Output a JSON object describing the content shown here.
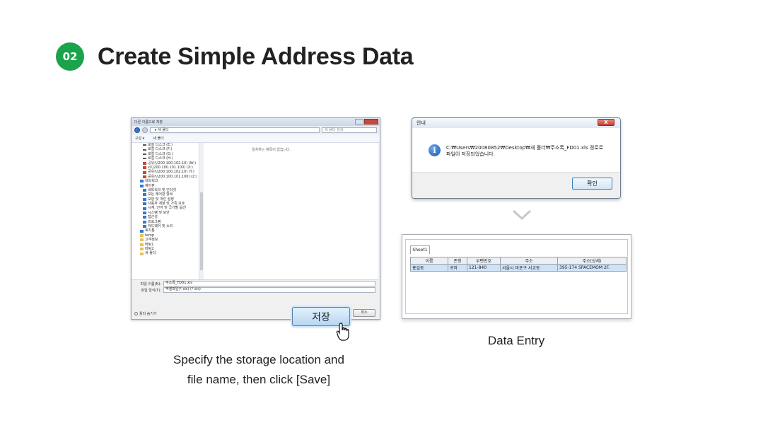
{
  "header": {
    "step_number": "02",
    "title": "Create Simple Address Data"
  },
  "save_dialog": {
    "title": "다른 이름으로 저장",
    "address": "▸ 새 폴더",
    "search_placeholder": "새 폴더 검색",
    "toolbar_organize": "구성 ▾",
    "toolbar_new_folder": "새 폴더",
    "empty_message": "일치하는 항목이 없습니다.",
    "tree_items": [
      {
        "label": "로컬 디스크 (E:)",
        "icon": "drive-icon"
      },
      {
        "label": "로컬 디스크 (F:)",
        "icon": "drive-icon"
      },
      {
        "label": "로컬 디스크 (G:)",
        "icon": "drive-icon"
      },
      {
        "label": "로컬 디스크 (H:)",
        "icon": "drive-icon"
      },
      {
        "label": "공유(\\\\200.100.102.10) (W:)",
        "icon": "network-drive-icon"
      },
      {
        "label": "x(\\\\200.100.101.100) (X:)",
        "icon": "network-drive-icon"
      },
      {
        "label": "공유(\\\\200.100.102.10) (Y:)",
        "icon": "network-drive-icon"
      },
      {
        "label": "공유(\\\\200.100.101.100) (Z:)",
        "icon": "network-drive-icon"
      },
      {
        "label": "네트워크",
        "icon": "network-icon"
      },
      {
        "label": "제어판",
        "icon": "control-panel-icon"
      },
      {
        "label": "네트워크 및 인터넷",
        "icon": "network-icon"
      },
      {
        "label": "모든 제어판 항목",
        "icon": "control-panel-icon"
      },
      {
        "label": "모양 및 개인 설정",
        "icon": "personalize-icon"
      },
      {
        "label": "사용자 계정 및 가족 보호",
        "icon": "user-icon"
      },
      {
        "label": "시계, 언어 및 국가별 옵션",
        "icon": "clock-icon"
      },
      {
        "label": "시스템 및 보안",
        "icon": "security-icon"
      },
      {
        "label": "접근성",
        "icon": "accessibility-icon"
      },
      {
        "label": "프로그램",
        "icon": "program-icon"
      },
      {
        "label": "하드웨어 및 소리",
        "icon": "hardware-icon"
      },
      {
        "label": "휴지통",
        "icon": "recycle-bin-icon"
      },
      {
        "label": "temp",
        "icon": "folder-icon"
      },
      {
        "label": "고객정보",
        "icon": "folder-icon"
      },
      {
        "label": "바탕1",
        "icon": "folder-icon"
      },
      {
        "label": "바탕2",
        "icon": "folder-icon"
      },
      {
        "label": "새 폴더",
        "icon": "folder-icon"
      }
    ],
    "filename_label": "파일 이름(N):",
    "filename_value": "주소록_FD01.xls",
    "filetype_label": "파일 형식(T):",
    "filetype_value": "엑셀파일(*.xls) (*.xls)",
    "hide_folders": "폴더 숨기기",
    "save_label": "저장",
    "cancel_label": "취소"
  },
  "caption_left": {
    "line1": "Specify the storage location and",
    "line2": "file name, then click [Save]"
  },
  "message_box": {
    "title": "안내",
    "close_label": "X",
    "message": "C:₩Users₩20080852₩Desktop₩새 폴더₩주소록_FD01.xls 경로로 파일이 저장되었습니다.",
    "ok_label": "확인"
  },
  "spreadsheet": {
    "tab": "Sheet1",
    "columns": [
      "이름",
      "존칭",
      "우편번호",
      "주소",
      "주소(상세)"
    ],
    "rows": [
      [
        "홍길동",
        "귀하",
        "121-840",
        "서울시 마포구 서교동",
        "395-174 SPACEMOM 2F."
      ]
    ]
  },
  "caption_right": "Data Entry",
  "colors": {
    "badge": "#1aa34a",
    "selection": "#cfe3f7",
    "close": "#c63c2c"
  }
}
